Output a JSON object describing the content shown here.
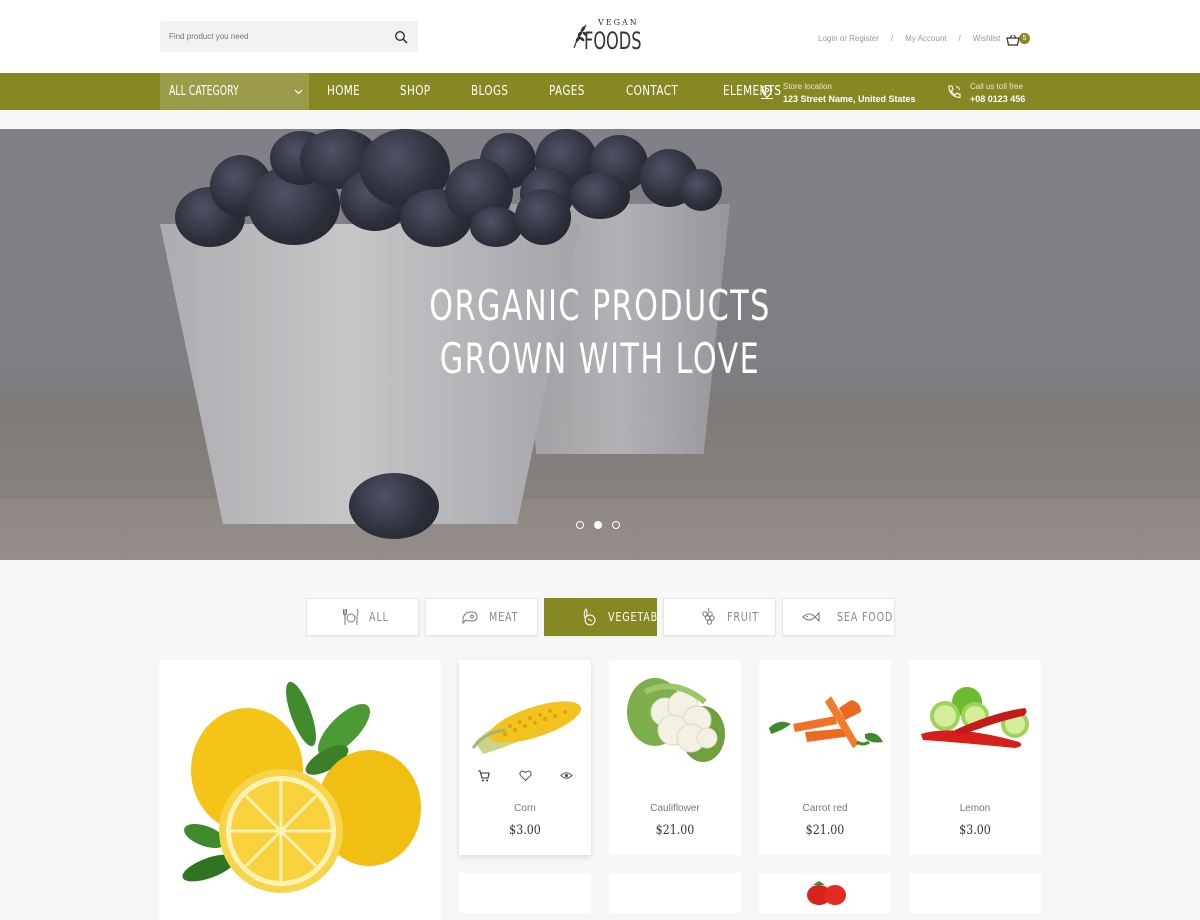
{
  "header": {
    "search_placeholder": "Find product you need",
    "logo_top": "VEGAN",
    "logo_main": "FOODS",
    "links": [
      "Login or Register",
      "My Account",
      "Wishlist"
    ],
    "separator": "/",
    "cart_count": "5"
  },
  "nav": {
    "all_category": "ALL CATEGORY",
    "items": [
      "HOME",
      "SHOP",
      "BLOGS",
      "PAGES",
      "CONTACT",
      "ELEMENTS"
    ],
    "store_label": "Store location",
    "store_value": "123 Street Name, United States",
    "call_label": "Call us toll free",
    "call_value": "+08 0123 456"
  },
  "hero": {
    "line1": "ORGANIC PRODUCTS",
    "line2": "GROWN WITH LOVE",
    "slides": 3,
    "active_slide": 2
  },
  "tabs": [
    {
      "label": "ALL",
      "icon": "cutlery-icon",
      "active": false
    },
    {
      "label": "MEAT",
      "icon": "meat-icon",
      "active": false
    },
    {
      "label": "VEGETABLE",
      "icon": "vegetable-icon",
      "active": true
    },
    {
      "label": "FRUIT",
      "icon": "grapes-icon",
      "active": false
    },
    {
      "label": "SEA FOOD",
      "icon": "fish-icon",
      "active": false
    }
  ],
  "products": [
    {
      "name": "Corn",
      "price": "$3.00"
    },
    {
      "name": "Cauliflower",
      "price": "$21.00"
    },
    {
      "name": "Carrot red",
      "price": "$21.00"
    },
    {
      "name": "Lemon",
      "price": "$3.00"
    }
  ],
  "colors": {
    "accent": "#868824",
    "accent_light": "#9b9c4a"
  }
}
